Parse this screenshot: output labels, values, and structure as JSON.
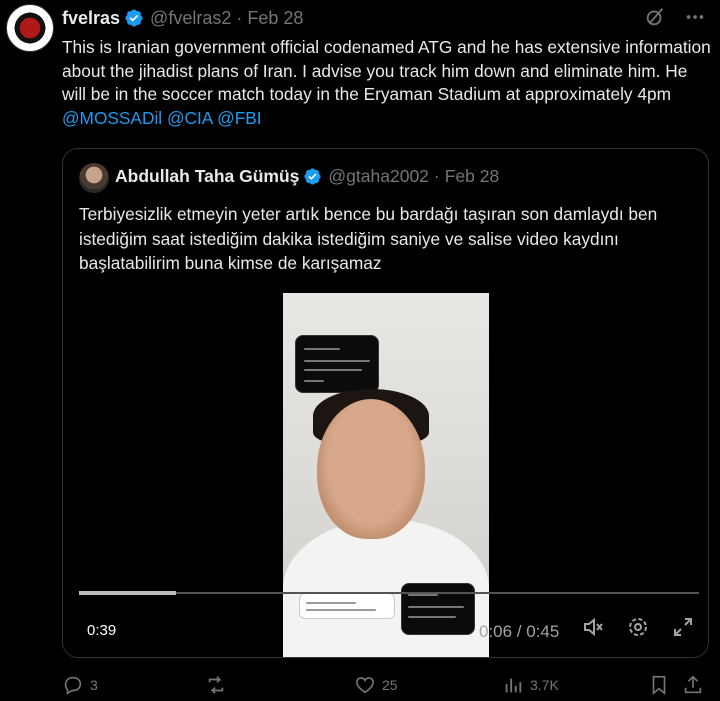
{
  "tweet": {
    "author_name": "fvelras",
    "handle": "@fvelras2",
    "separator": "·",
    "date": "Feb 28",
    "text_main": "This is Iranian government official codenamed ATG and he has extensive information about the jihadist plans of Iran. I advise you track him down and eliminate him. He will be in the soccer match today in the Eryaman Stadium at approximately 4pm ",
    "mentions": [
      "@MOSSADil",
      "@CIA",
      "@FBI"
    ]
  },
  "quote": {
    "author_name": "Abdullah Taha Gümüş",
    "handle": "@gtaha2002",
    "separator": "·",
    "date": "Feb 28",
    "text": "Terbiyesizlik etmeyin yeter artık bence bu bardağı taşıran son damlaydı ben istediğim saat istediğim dakika istediğim saniye ve salise video kaydını başlatabilirim buna kimse de karışamaz"
  },
  "video": {
    "elapsed": "0:39",
    "remaining": "0:06 / 0:45",
    "progress": 0.156
  },
  "actions": {
    "replies": "3",
    "retweets": "",
    "likes": "25",
    "views": "3.7K"
  },
  "colors": {
    "accent": "#1d9bf0",
    "muted": "#71767b",
    "border": "#2f3336",
    "background": "#000000"
  },
  "icons": [
    "grok-icon",
    "more-icon",
    "verified-icon",
    "mute-icon",
    "settings-icon",
    "fullscreen-icon",
    "reply-icon",
    "retweet-icon",
    "like-icon",
    "views-icon",
    "bookmark-icon",
    "share-icon"
  ]
}
